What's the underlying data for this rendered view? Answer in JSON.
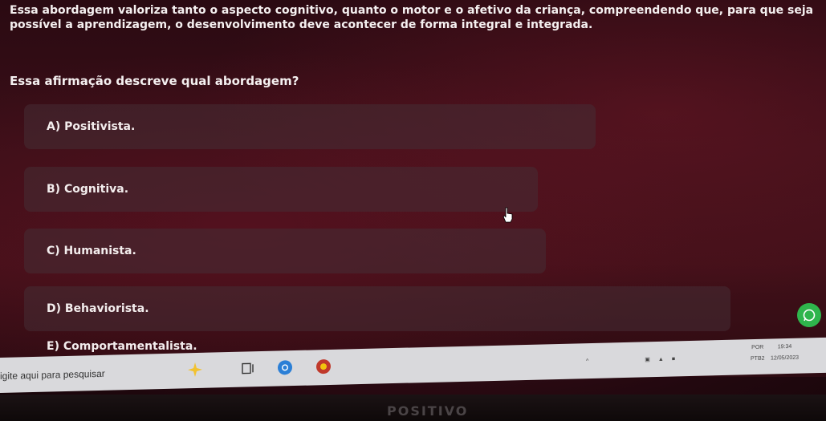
{
  "question": {
    "text": "Essa abordagem valoriza tanto o aspecto cognitivo, quanto o motor e o afetivo da criança, compreendendo que, para que seja possível a aprendizagem, o desenvolvimento deve acontecer de forma integral e integrada.",
    "prompt": "Essa afirmação descreve qual abordagem?"
  },
  "options": [
    {
      "label": "A) Positivista."
    },
    {
      "label": "B) Cognitiva."
    },
    {
      "label": "C) Humanista."
    },
    {
      "label": "D) Behaviorista."
    },
    {
      "label": "E) Comportamentalista."
    }
  ],
  "taskbar": {
    "search_placeholder": "igite aqui para pesquisar",
    "icons": [
      "sparkle-icon",
      "task-view-icon",
      "chrome-icon",
      "app-icon"
    ],
    "tray_icons": [
      "chevron-up-icon",
      "network-icon",
      "volume-icon",
      "battery-icon"
    ],
    "language": {
      "line1": "POR",
      "line2": "PTB2"
    },
    "time": "19:34",
    "date": "12/05/2023"
  },
  "monitor_brand": "POSITIVO",
  "colors": {
    "background": "#3b0f18",
    "option_bg": "#46343a",
    "taskbar": "#d9d9dc",
    "whatsapp": "#2fb54c"
  }
}
